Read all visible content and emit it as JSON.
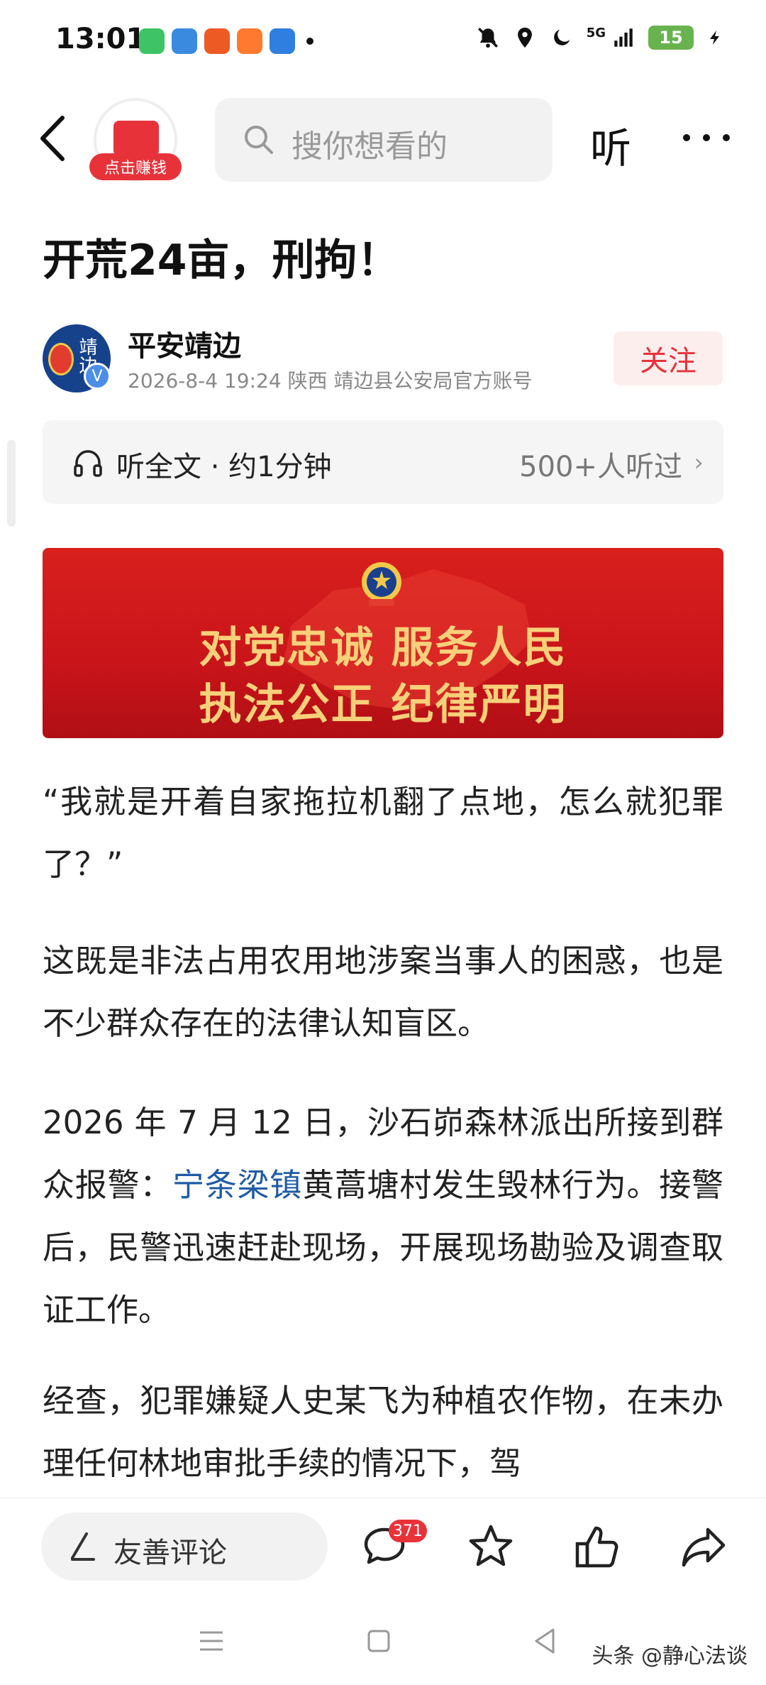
{
  "status_bar": {
    "time": "13:01",
    "battery": "15",
    "network": "5G"
  },
  "nav": {
    "earn_badge": "点击赚钱",
    "search_placeholder": "搜你想看的",
    "listen_label": "听"
  },
  "article": {
    "title": "开荒24亩，刑拘！",
    "author": {
      "name": "平安靖边",
      "avatar_text": "靖边",
      "meta": "2026-8-4  19:24  陕西  靖边县公安局官方账号",
      "follow_label": "关注"
    },
    "audio": {
      "label": "听全文 · 约1分钟",
      "listeners": "500+人听过"
    },
    "banner": {
      "line1": "对党忠诚  服务人民",
      "line2": "执法公正  纪律严明"
    },
    "p1": "“我就是开着自家拖拉机翻了点地，怎么就犯罪了？”",
    "p2": "这既是非法占用农用地涉案当事人的困惑，也是不少群众存在的法律认知盲区。",
    "p3_before": "2026 年 7 月 12 日，沙石峁森林派出所接到群众报警：",
    "p3_link": "宁条梁镇",
    "p3_after": "黄蒿塘村发生毁林行为。接警后，民警迅速赶赴现场，开展现场勘验及调查取证工作。",
    "p4": "经查，犯罪嫌疑人史某飞为种植农作物，在未办理任何林地审批手续的情况下，驾"
  },
  "bottom_bar": {
    "comment_placeholder": "友善评论",
    "comment_count": "371"
  },
  "watermark": "头条 @静心法谈",
  "colors": {
    "accent_red": "#e8323a",
    "link_blue": "#1f5ba5",
    "banner_gold": "#f7d07a"
  }
}
